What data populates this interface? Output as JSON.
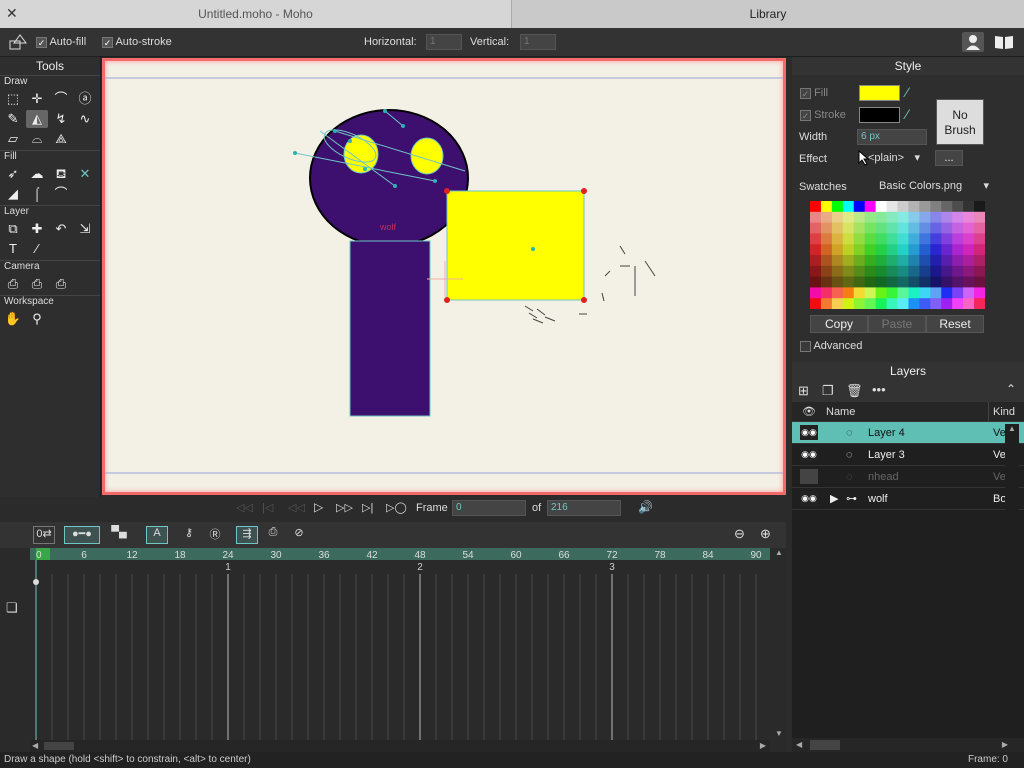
{
  "tabs": {
    "document": "Untitled.moho - Moho",
    "library": "Library",
    "close_glyph": "✕"
  },
  "options": {
    "auto_fill": "Auto-fill",
    "auto_stroke": "Auto-stroke",
    "horizontal_label": "Horizontal:",
    "vertical_label": "Vertical:",
    "horizontal_value": "1",
    "vertical_value": "1"
  },
  "tools": {
    "title": "Tools",
    "sections": {
      "draw": "Draw",
      "fill": "Fill",
      "layer": "Layer",
      "camera": "Camera",
      "workspace": "Workspace"
    }
  },
  "style": {
    "title": "Style",
    "fill_label": "Fill",
    "stroke_label": "Stroke",
    "width_label": "Width",
    "width_value": "6 px",
    "effect_label": "Effect",
    "effect_value": "<plain>",
    "effect_more": "...",
    "no_brush": "No Brush",
    "swatches_label": "Swatches",
    "swatches_value": "Basic Colors.png",
    "copy": "Copy",
    "paste": "Paste",
    "reset": "Reset",
    "advanced": "Advanced",
    "fill_color": "#ffff00",
    "stroke_color": "#000000"
  },
  "layers": {
    "title": "Layers",
    "col_name": "Name",
    "col_kind": "Kind",
    "rows": [
      {
        "name": "Layer 4",
        "kind": "Ve"
      },
      {
        "name": "Layer 3",
        "kind": "Ve"
      },
      {
        "name": "nhead",
        "kind": "Ve"
      },
      {
        "name": "wolf",
        "kind": "Bo"
      }
    ]
  },
  "playback": {
    "frame_label": "Frame",
    "frame_value": "0",
    "of_label": "of",
    "total_frames": "216"
  },
  "timeline": {
    "ruler": [
      "0",
      "6",
      "12",
      "18",
      "24",
      "30",
      "36",
      "42",
      "48",
      "54",
      "60",
      "66",
      "72",
      "78",
      "84",
      "90"
    ],
    "seconds": [
      "1",
      "2",
      "3"
    ]
  },
  "status": {
    "hint": "Draw a shape (hold <shift> to constrain, <alt> to center)",
    "frame": "Frame: 0"
  },
  "canvas": {
    "bone_label": "wolf"
  }
}
